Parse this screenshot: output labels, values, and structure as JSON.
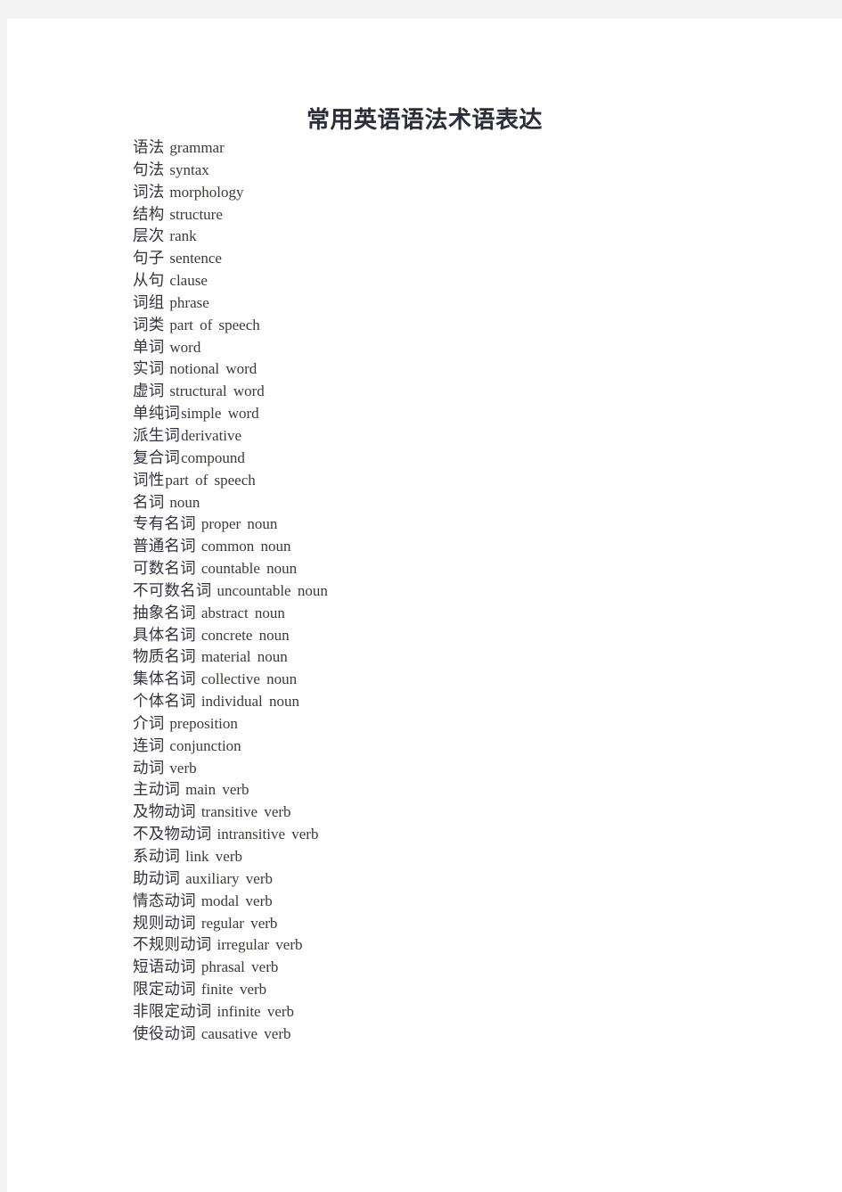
{
  "document": {
    "title": "常用英语语法术语表达",
    "page_background": "#f4f4f4",
    "sheet_background": "#ffffff",
    "text_color": "#3a3a46"
  },
  "terms": [
    {
      "zh": "语法",
      "en": "grammar",
      "tight": false
    },
    {
      "zh": "句法",
      "en": "syntax",
      "tight": false
    },
    {
      "zh": "词法",
      "en": "morphology",
      "tight": false
    },
    {
      "zh": "结构",
      "en": "structure",
      "tight": false
    },
    {
      "zh": "层次",
      "en": "rank",
      "tight": false
    },
    {
      "zh": "句子",
      "en": "sentence",
      "tight": false
    },
    {
      "zh": "从句",
      "en": "clause",
      "tight": false
    },
    {
      "zh": "词组",
      "en": "phrase",
      "tight": false
    },
    {
      "zh": "词类",
      "en": "part of speech",
      "tight": false
    },
    {
      "zh": "单词",
      "en": "word",
      "tight": false
    },
    {
      "zh": "实词",
      "en": "notional word",
      "tight": false
    },
    {
      "zh": "虚词",
      "en": "structural word",
      "tight": false
    },
    {
      "zh": "单纯词",
      "en": "simple word",
      "tight": true
    },
    {
      "zh": "派生词",
      "en": "derivative",
      "tight": true
    },
    {
      "zh": "复合词",
      "en": "compound",
      "tight": true
    },
    {
      "zh": "词性",
      "en": "part of speech",
      "tight": true
    },
    {
      "zh": "名词",
      "en": "noun",
      "tight": false
    },
    {
      "zh": "专有名词",
      "en": "proper noun",
      "tight": false
    },
    {
      "zh": "普通名词",
      "en": "common noun",
      "tight": false
    },
    {
      "zh": "可数名词",
      "en": "countable noun",
      "tight": false
    },
    {
      "zh": "不可数名词",
      "en": "uncountable noun",
      "tight": false
    },
    {
      "zh": "抽象名词",
      "en": "abstract noun",
      "tight": false
    },
    {
      "zh": "具体名词",
      "en": "concrete noun",
      "tight": false
    },
    {
      "zh": "物质名词",
      "en": "material noun",
      "tight": false
    },
    {
      "zh": "集体名词",
      "en": "collective noun",
      "tight": false
    },
    {
      "zh": "个体名词",
      "en": "individual noun",
      "tight": false
    },
    {
      "zh": "介词",
      "en": "preposition",
      "tight": false
    },
    {
      "zh": "连词",
      "en": "conjunction",
      "tight": false
    },
    {
      "zh": "动词",
      "en": "verb",
      "tight": false
    },
    {
      "zh": "主动词",
      "en": "main verb",
      "tight": false
    },
    {
      "zh": "及物动词",
      "en": "transitive verb",
      "tight": false
    },
    {
      "zh": "不及物动词",
      "en": "intransitive verb",
      "tight": false
    },
    {
      "zh": "系动词",
      "en": "link verb",
      "tight": false
    },
    {
      "zh": "助动词",
      "en": "auxiliary verb",
      "tight": false
    },
    {
      "zh": "情态动词",
      "en": "modal verb",
      "tight": false
    },
    {
      "zh": "规则动词",
      "en": "regular verb",
      "tight": false
    },
    {
      "zh": "不规则动词",
      "en": "irregular verb",
      "tight": false
    },
    {
      "zh": "短语动词",
      "en": "phrasal verb",
      "tight": false
    },
    {
      "zh": "限定动词",
      "en": "finite verb",
      "tight": false
    },
    {
      "zh": "非限定动词",
      "en": "infinite verb",
      "tight": false
    },
    {
      "zh": "使役动词",
      "en": "causative verb",
      "tight": false
    }
  ]
}
